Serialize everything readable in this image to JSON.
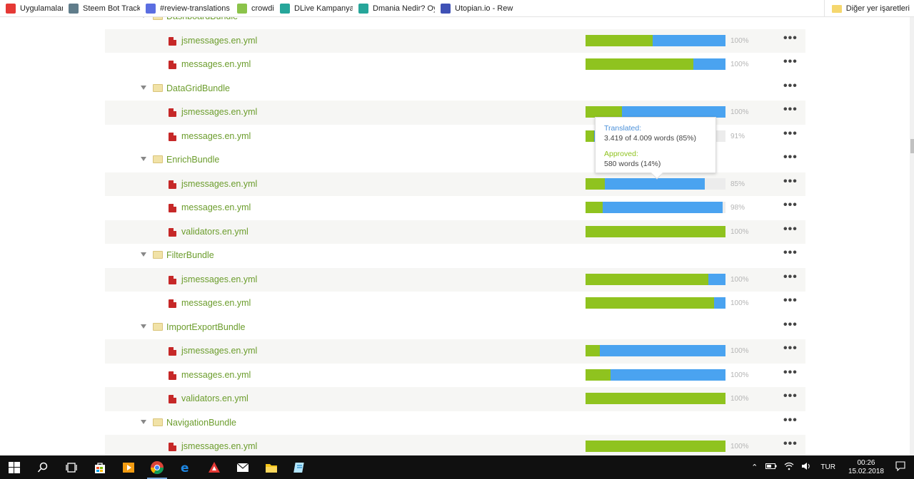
{
  "bookmarks": [
    {
      "label": "Uygulamalar",
      "icon": "apps-grid-icon",
      "color": "#e53935"
    },
    {
      "label": "Steem Bot Tracker",
      "icon": "robot-icon",
      "color": "#607d8b"
    },
    {
      "label": "#review-translations",
      "icon": "discord-icon",
      "color": "#5b6ee1"
    },
    {
      "label": "crowdin",
      "icon": "crowdin-icon",
      "color": "#8bc34a"
    },
    {
      "label": "DLive Kampanyası! –",
      "icon": "dlive-icon",
      "color": "#26a69a"
    },
    {
      "label": "Dmania Nedir? Oy alı",
      "icon": "dmania-icon",
      "color": "#26a69a"
    },
    {
      "label": "Utopian.io - Rewardin",
      "icon": "utopian-icon",
      "color": "#3f51b5"
    }
  ],
  "bookmarks_other": "Diğer yer işaretleri",
  "rows": [
    {
      "kind": "dir",
      "name": "DashboardBundle"
    },
    {
      "kind": "file",
      "name": "jsmessages.en.yml",
      "translated": 1.0,
      "approved": 0.48,
      "pct": "100%"
    },
    {
      "kind": "file",
      "name": "messages.en.yml",
      "translated": 1.0,
      "approved": 0.77,
      "pct": "100%"
    },
    {
      "kind": "dir",
      "name": "DataGridBundle"
    },
    {
      "kind": "file",
      "name": "jsmessages.en.yml",
      "translated": 1.0,
      "approved": 0.26,
      "pct": "100%"
    },
    {
      "kind": "file",
      "name": "messages.en.yml",
      "translated": 0.91,
      "approved": 0.06,
      "pct": "91%"
    },
    {
      "kind": "dir",
      "name": "EnrichBundle"
    },
    {
      "kind": "file",
      "name": "jsmessages.en.yml",
      "translated": 0.85,
      "approved": 0.14,
      "pct": "85%"
    },
    {
      "kind": "file",
      "name": "messages.en.yml",
      "translated": 0.98,
      "approved": 0.12,
      "pct": "98%"
    },
    {
      "kind": "file",
      "name": "validators.en.yml",
      "translated": 1.0,
      "approved": 1.0,
      "pct": "100%"
    },
    {
      "kind": "dir",
      "name": "FilterBundle"
    },
    {
      "kind": "file",
      "name": "jsmessages.en.yml",
      "translated": 1.0,
      "approved": 0.88,
      "pct": "100%"
    },
    {
      "kind": "file",
      "name": "messages.en.yml",
      "translated": 1.0,
      "approved": 0.92,
      "pct": "100%"
    },
    {
      "kind": "dir",
      "name": "ImportExportBundle"
    },
    {
      "kind": "file",
      "name": "jsmessages.en.yml",
      "translated": 1.0,
      "approved": 0.1,
      "pct": "100%"
    },
    {
      "kind": "file",
      "name": "messages.en.yml",
      "translated": 1.0,
      "approved": 0.18,
      "pct": "100%"
    },
    {
      "kind": "file",
      "name": "validators.en.yml",
      "translated": 1.0,
      "approved": 1.0,
      "pct": "100%"
    },
    {
      "kind": "dir",
      "name": "NavigationBundle"
    },
    {
      "kind": "file",
      "name": "jsmessages.en.yml",
      "translated": 1.0,
      "approved": 1.0,
      "pct": "100%"
    }
  ],
  "tooltip": {
    "translated_label": "Translated:",
    "translated_value": "3.419 of 4.009 words (85%)",
    "approved_label": "Approved:",
    "approved_value": "580 words (14%)"
  },
  "more_label": "•••",
  "taskbar": {
    "language": "TUR",
    "time": "00:26",
    "date": "15.02.2018"
  },
  "colors": {
    "translated": "#4aa3f0",
    "approved": "#8fc31f",
    "link": "#6c9d2d"
  }
}
